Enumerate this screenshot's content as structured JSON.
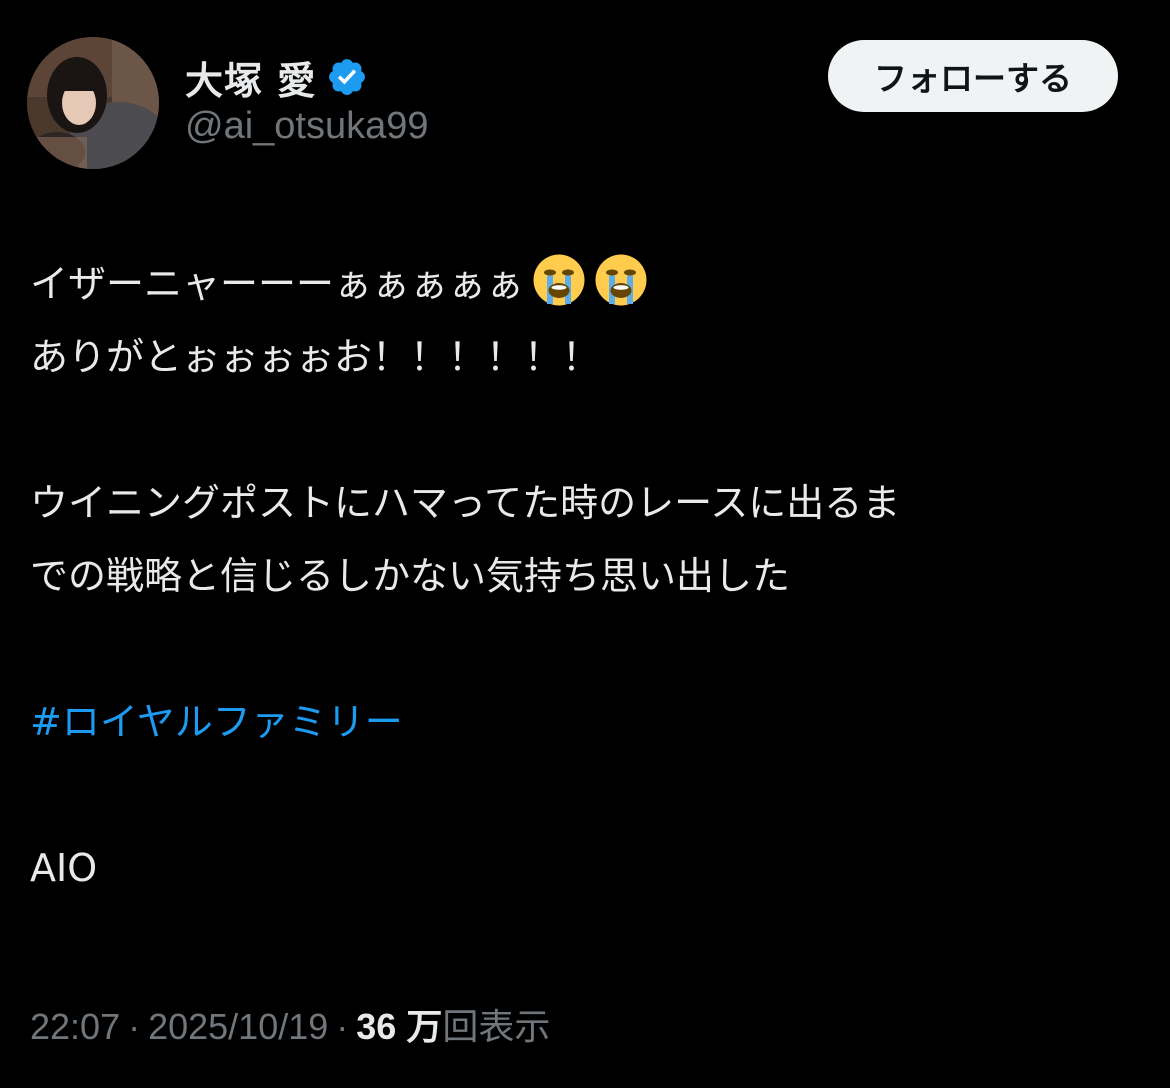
{
  "user": {
    "display_name": "大塚 愛",
    "handle": "@ai_otsuka99",
    "verified": true,
    "verified_color": "#1d9bf0"
  },
  "follow_button": {
    "label": "フォローする"
  },
  "tweet": {
    "line1": "イザーニャーーーぁぁぁぁぁ",
    "line1_emoji": [
      "loudly-crying-face",
      "loudly-crying-face"
    ],
    "line2": "ありがとぉぉぉぉお！！！！！！",
    "line3": "ウイニングポストにハマってた時のレースに出るま",
    "line4": "での戦略と信じるしかない気持ち思い出した",
    "hashtag": "#ロイヤルファミリー",
    "signature": "AIO"
  },
  "meta": {
    "time": "22:07",
    "separator": "·",
    "date": "2025/10/19",
    "views_count": "36 万",
    "views_label": "回表示"
  },
  "colors": {
    "background": "#000000",
    "text": "#e7e9ea",
    "secondary": "#71767b",
    "link": "#1d9bf0",
    "button_bg": "#eff3f4"
  }
}
